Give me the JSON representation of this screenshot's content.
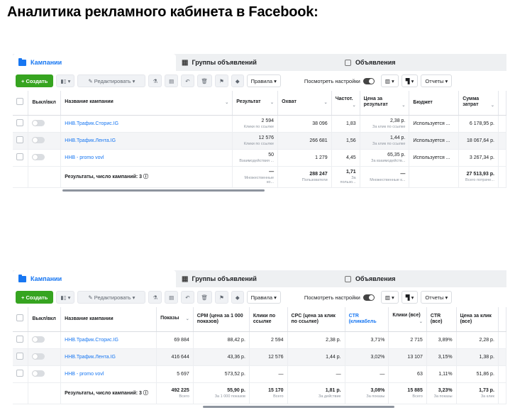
{
  "page_title": "Аналитика рекламного кабинета в Facebook:",
  "colors": {
    "accent": "#1877f2",
    "create": "#36a420"
  },
  "tabs": [
    "Кампании",
    "Группы объявлений",
    "Объявления"
  ],
  "toolbar": {
    "create": "+ Создать",
    "edit": "Редактировать",
    "rules": "Правила",
    "view_settings": "Посмотреть настройки",
    "reports": "Отчеты"
  },
  "common_headers": {
    "onoff": "Выкл/вкл",
    "name": "Название кампании"
  },
  "campaigns": [
    "ННВ.Трафик.Сторис.IG",
    "ННВ.Трафик.Лента.IG",
    "ННВ - promo vovl"
  ],
  "summary_label": "Результаты, число кампаний: 3",
  "table1": {
    "headers": [
      "Результат",
      "Охват",
      "Частот.",
      "Цена за результат",
      "Бюджет",
      "Сумма затрат"
    ],
    "rows": [
      {
        "result": "2 594",
        "result_sub": "Клики по ссылке",
        "reach": "38 096",
        "freq": "1,83",
        "cpr": "2,38 р.",
        "cpr_sub": "За клик по ссылке",
        "budget": "Используется ...",
        "spend": "6 178,95 р."
      },
      {
        "result": "12 576",
        "result_sub": "Клики по ссылке",
        "reach": "266 681",
        "freq": "1,56",
        "cpr": "1,44 р.",
        "cpr_sub": "За клик по ссылке",
        "budget": "Используется ...",
        "spend": "18 067,64 р."
      },
      {
        "result": "50",
        "result_sub": "Взаимодействия ...",
        "reach": "1 279",
        "freq": "4,45",
        "cpr": "65,35 р.",
        "cpr_sub": "За взаимодейств...",
        "budget": "Используется ...",
        "spend": "3 267,34 р."
      }
    ],
    "summary": {
      "result": "—",
      "result_sub": "Множественные ко...",
      "reach": "288 247",
      "reach_sub": "Пользователи",
      "freq": "1,71",
      "freq_sub": "За пользо...",
      "cpr": "—",
      "cpr_sub": "Множественные к...",
      "spend": "27 513,93 р.",
      "spend_sub": "Всего потраче..."
    }
  },
  "table2": {
    "headers": [
      "Показы",
      "CPM (цена за 1 000 показов)",
      "Клики по ссылке",
      "CPC (цена за клик по ссылке)",
      "CTR (кликабель",
      "Клики (все)",
      "CTR (все)",
      "Цена за клик (все)"
    ],
    "rows": [
      {
        "impr": "69 884",
        "cpm": "88,42 р.",
        "clicks": "2 594",
        "cpc": "2,38 р.",
        "ctr": "3,71%",
        "clicks_all": "2 715",
        "ctr_all": "3,89%",
        "cpc_all": "2,28 р."
      },
      {
        "impr": "416 644",
        "cpm": "43,36 р.",
        "clicks": "12 576",
        "cpc": "1,44 р.",
        "ctr": "3,02%",
        "clicks_all": "13 107",
        "ctr_all": "3,15%",
        "cpc_all": "1,38 р."
      },
      {
        "impr": "5 697",
        "cpm": "573,52 р.",
        "clicks": "—",
        "cpc": "—",
        "ctr": "—",
        "clicks_all": "63",
        "ctr_all": "1,11%",
        "cpc_all": "51,86 р."
      }
    ],
    "summary": {
      "impr": "492 225",
      "impr_sub": "Всего",
      "cpm": "55,90 р.",
      "cpm_sub": "За 1 000 показов",
      "clicks": "15 170",
      "clicks_sub": "Всего",
      "cpc": "1,81 р.",
      "cpc_sub": "За действие",
      "ctr": "3,08%",
      "ctr_sub": "За показы",
      "clicks_all": "15 885",
      "clicks_all_sub": "Всего",
      "ctr_all": "3,23%",
      "ctr_all_sub": "За показы",
      "cpc_all": "1,73 р.",
      "cpc_all_sub": "За клик"
    }
  }
}
